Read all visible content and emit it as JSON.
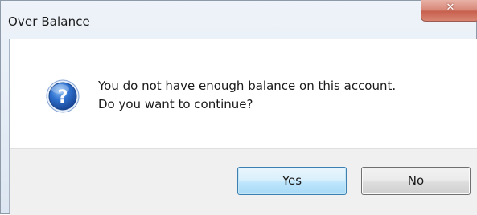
{
  "dialog": {
    "title": "Over Balance",
    "message_line1": "You do not have enough balance on this account.",
    "message_line2": "Do you want to continue?",
    "icon": "question-icon",
    "close_icon": "close-icon"
  },
  "buttons": {
    "yes_label": "Yes",
    "no_label": "No",
    "default": "Yes"
  },
  "colors": {
    "icon_blue": "#1f5fbf",
    "close_red": "#c7604e",
    "default_button_border": "#3c7fb1"
  }
}
